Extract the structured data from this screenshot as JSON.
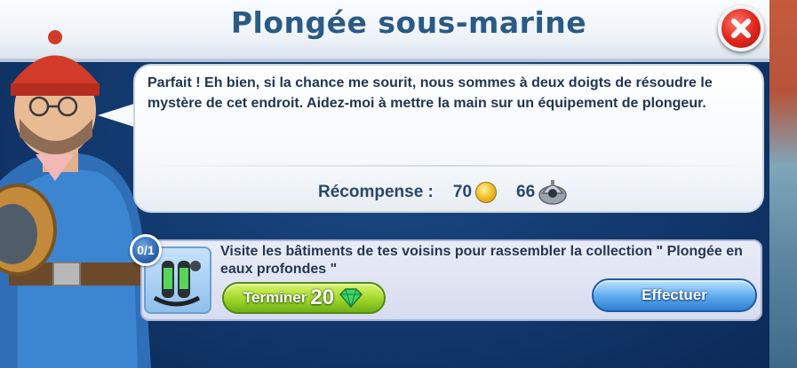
{
  "dialog": {
    "title": "Plongée sous-marine",
    "close_icon": "close-icon"
  },
  "speech": {
    "text": "Parfait ! Eh bien, si la chance me sourit, nous sommes à deux doigts de résoudre le mystère de cet endroit. Aidez-moi à mettre la main sur un équipement de plongeur."
  },
  "reward": {
    "label": "Récompense :",
    "coins": "70",
    "coin_icon": "coin-icon",
    "xp": "66",
    "xp_icon": "diving-helmet-icon"
  },
  "quest": {
    "progress": "0/1",
    "text": "Visite les bâtiments de tes voisins pour rassembler la collection \" Plongée en eaux profondes \"",
    "thumbnail_icon": "diving-gear-icon",
    "finish_label": "Terminer",
    "finish_cost": "20",
    "gem_icon": "gem-icon",
    "do_label": "Effectuer"
  },
  "colors": {
    "title": "#2a5a86",
    "close": "#e3291e",
    "finish_button": "#9fd62b",
    "do_button": "#63aef0"
  }
}
